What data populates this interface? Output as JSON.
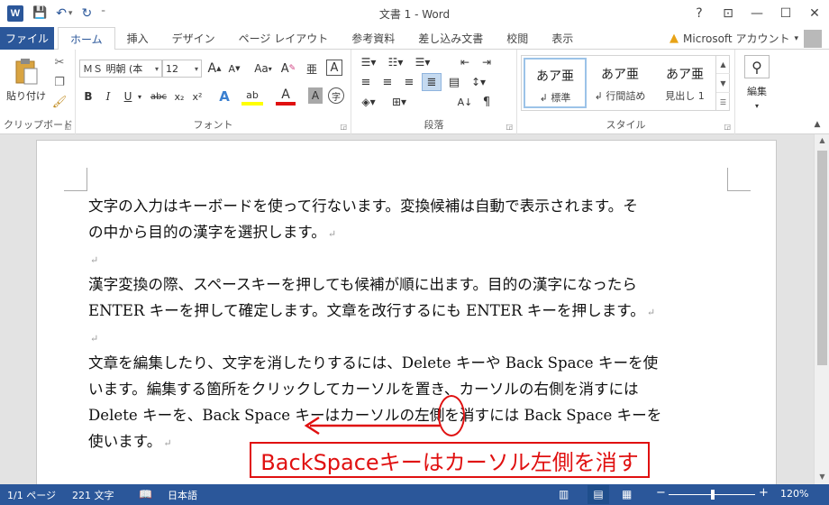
{
  "window": {
    "title": "文書 1 - Word",
    "app_icon_letter": "W",
    "help": "?",
    "ribbon_display": "⊡",
    "minimize": "—",
    "restore": "☐",
    "close": "✕"
  },
  "qat": {
    "save": "💾",
    "undo": "↶",
    "undo_menu": "▾",
    "redo": "↻",
    "customize": "⁼"
  },
  "tabs": {
    "file": "ファイル",
    "items": [
      "ホーム",
      "挿入",
      "デザイン",
      "ページ レイアウト",
      "参考資料",
      "差し込み文書",
      "校閲",
      "表示"
    ]
  },
  "account": {
    "label": "Microsoft アカウント",
    "menu": "▾"
  },
  "ribbon": {
    "clipboard": {
      "label": "クリップボード",
      "paste": "貼り付け"
    },
    "font": {
      "label": "フォント",
      "name": "ＭＳ 明朝 (本",
      "size": "12",
      "grow": "A",
      "shrink": "A",
      "case": "Aa",
      "clear": "A",
      "phonetic": "亜",
      "border": "A",
      "bold": "B",
      "italic": "I",
      "underline": "U",
      "strike": "abc",
      "sub": "x₂",
      "sup": "x²",
      "effects": "A",
      "highlight": "ab",
      "color": "A",
      "shade": "A",
      "enclose": "字"
    },
    "paragraph": {
      "label": "段落"
    },
    "styles": {
      "label": "スタイル",
      "items": [
        {
          "sample": "あア亜",
          "name": "↲ 標準"
        },
        {
          "sample": "あア亜",
          "name": "↲ 行間詰め"
        },
        {
          "sample": "あア亜",
          "name": "見出し 1"
        }
      ]
    },
    "editing": {
      "label": "編集"
    }
  },
  "document": {
    "lines": [
      {
        "text": "文字の入力はキーボードを使って行ないます。変換候補は自動で表示されます。そ",
        "mark": ""
      },
      {
        "text": "の中から目的の漢字を選択します。",
        "mark": "↵"
      },
      {
        "text": "",
        "mark": "↵"
      },
      {
        "text": "漢字変換の際、スペースキーを押しても候補が順に出ます。目的の漢字になったら",
        "mark": ""
      },
      {
        "text": "ENTER キーを押して確定します。文章を改行するにも ENTER キーを押します。",
        "mark": "↵"
      },
      {
        "text": "",
        "mark": "↵"
      },
      {
        "text": "文章を編集したり、文字を消したりするには、Delete キーや Back Space キーを使",
        "mark": ""
      },
      {
        "text": "います。編集する箇所をクリックしてカーソルを置き、カーソルの右側を消すには",
        "mark": ""
      },
      {
        "text": "Delete キーを、Back Space キーはカーソルの左側を消すには Back Space キーを",
        "mark": ""
      },
      {
        "text": "使います。",
        "mark": "↵"
      }
    ]
  },
  "annotation": {
    "text": "BackSpaceキーはカーソル左側を消す",
    "color": "#e01010"
  },
  "status": {
    "page": "1/1 ページ",
    "words": "221 文字",
    "language": "日本語",
    "zoom_minus": "−",
    "zoom_plus": "+",
    "zoom": "120%"
  },
  "colors": {
    "accent": "#2b579a",
    "highlight": "#ffff00",
    "font_color": "#e01010"
  }
}
